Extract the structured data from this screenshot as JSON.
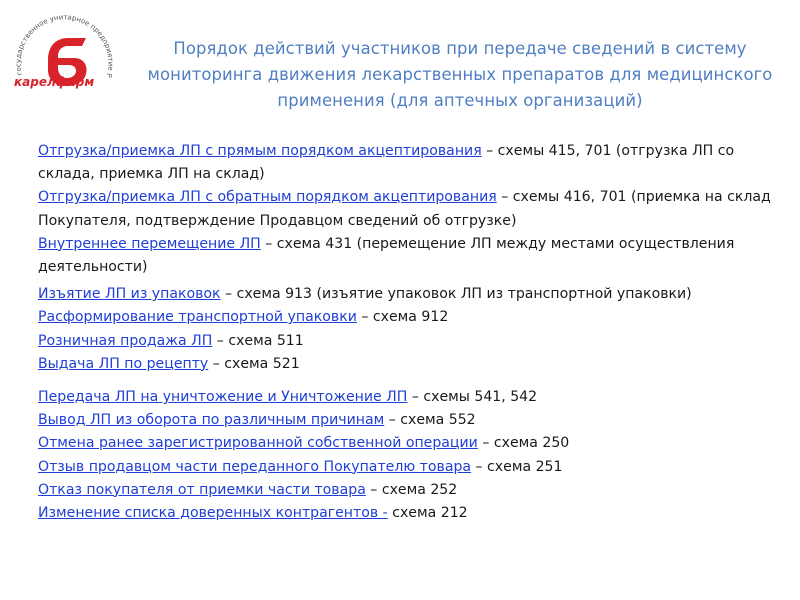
{
  "logo": {
    "brand": "карелфарм",
    "ring_text": "государственное унитарное предприятие РК",
    "mark_color": "#d8232a"
  },
  "title": "Порядок действий участников при передаче сведений в систему мониторинга движения лекарственных препаратов для медицинского применения (для аптечных организаций)",
  "colors": {
    "title": "#4f7ec2",
    "link": "#1f3fd6",
    "text": "#1a1a1a"
  },
  "groups": [
    {
      "items": [
        {
          "link": "Отгрузка/приемка ЛП с прямым порядком акцептирования",
          "rest": " – схемы 415, 701 (отгрузка ЛП со склада, приемка ЛП на склад)"
        },
        {
          "link": "Отгрузка/приемка ЛП с обратным порядком акцептирования",
          "rest": " – схемы 416, 701 (приемка на склад Покупателя, подтверждение Продавцом сведений об отгрузке)"
        },
        {
          "link": "Внутреннее перемещение ЛП",
          "rest": " – схема 431 (перемещение ЛП между местами осуществления деятельности)"
        }
      ]
    },
    {
      "items": [
        {
          "link": "Изъятие ЛП из упаковок",
          "rest": " – схема 913 (изъятие упаковок ЛП из транспортной упаковки)"
        },
        {
          "link": "Расформирование транспортной упаковки",
          "rest": " – схема 912"
        },
        {
          "link": "Розничная продажа ЛП",
          "rest": " – схема 511"
        },
        {
          "link": "Выдача ЛП по рецепту",
          "rest": " – схема 521"
        }
      ]
    },
    {
      "items": [
        {
          "link": "Передача ЛП на уничтожение и Уничтожение ЛП",
          "rest": " – схемы 541, 542"
        },
        {
          "link": "Вывод ЛП из оборота по различным причинам",
          "rest": " – схема 552"
        },
        {
          "link": "Отмена ранее зарегистрированной собственной операции",
          "rest": " – схема 250"
        },
        {
          "link": "Отзыв продавцом части переданного Покупателю товара",
          "rest": " – схема 251"
        },
        {
          "link": "Отказ покупателя от приемки части товара",
          "rest": " – схема 252"
        },
        {
          "link": "Изменение списка доверенных контрагентов -",
          "rest": " схема 212"
        }
      ]
    }
  ]
}
